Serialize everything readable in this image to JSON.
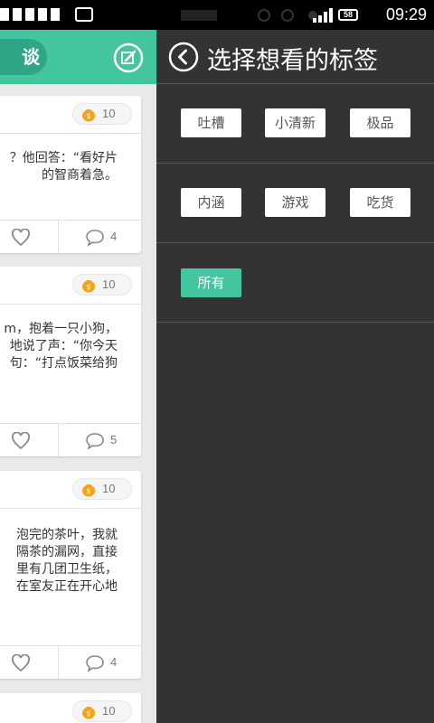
{
  "statusbar": {
    "time": "09:29",
    "battery": "58",
    "icons": [
      "signal-icon",
      "battery-icon"
    ]
  },
  "feed": {
    "header_tab_label": "谈",
    "compose_icon": "edit-icon",
    "cards": [
      {
        "coins": "10",
        "lines": [
          "？他回答：“看好片",
          "的智商着急。"
        ],
        "comments": "4"
      },
      {
        "coins": "10",
        "lines": [
          "m，抱着一只小狗，",
          "地说了声：“你今天",
          "句：“打点饭菜给狗"
        ],
        "comments": "5"
      },
      {
        "coins": "10",
        "lines": [
          "泡完的茶叶，我就",
          "隔茶的漏网，直接",
          "里有几团卫生纸，",
          "在室友正在开心地"
        ],
        "comments": "4"
      },
      {
        "coins": "10",
        "lines": [],
        "comments": ""
      }
    ]
  },
  "drawer": {
    "back_icon": "back-arrow-icon",
    "title": "选择想看的标签",
    "tags_row1": [
      "吐槽",
      "小清新",
      "极品"
    ],
    "tags_row2": [
      "内涵",
      "游戏",
      "吃货"
    ],
    "tags_row3": [
      "所有"
    ],
    "active_tag": "所有"
  },
  "colors": {
    "accent": "#43c6a0",
    "drawer_bg": "#333333",
    "feed_bg": "#e9e9e9"
  }
}
